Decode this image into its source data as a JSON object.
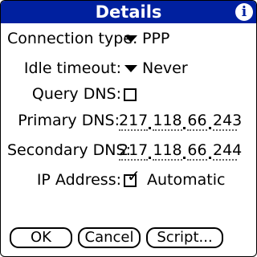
{
  "title": "Details",
  "icons": {
    "info": "info-icon",
    "dropdown": "triangle-down-icon",
    "check": "checkmark-icon"
  },
  "colors": {
    "titlebar": "#00209f"
  },
  "fields": {
    "connection_type": {
      "label": "Connection type:",
      "value": "PPP"
    },
    "idle_timeout": {
      "label": "Idle timeout:",
      "value": "Never"
    },
    "query_dns": {
      "label": "Query DNS:",
      "checked": false
    },
    "primary_dns": {
      "label": "Primary DNS:",
      "octets": [
        "217",
        "118",
        "66",
        "243"
      ]
    },
    "secondary_dns": {
      "label": "Secondary DNS:",
      "octets": [
        "217",
        "118",
        "66",
        "244"
      ]
    },
    "ip_address": {
      "label": "IP Address:",
      "checked": true,
      "value": "Automatic"
    }
  },
  "buttons": {
    "ok": "OK",
    "cancel": "Cancel",
    "script": "Script..."
  }
}
